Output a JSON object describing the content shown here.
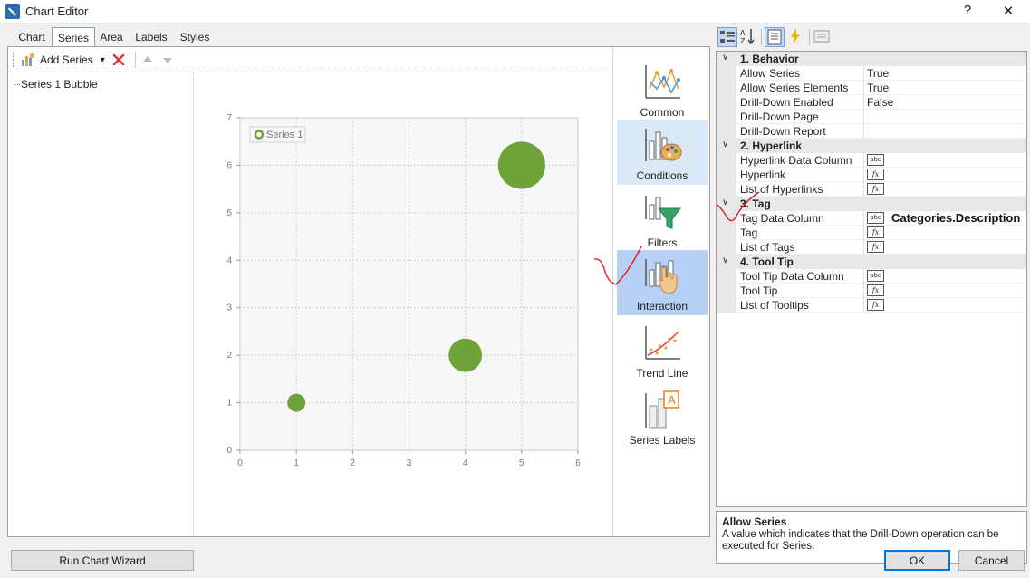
{
  "window": {
    "title": "Chart Editor",
    "help": "?",
    "close": "✕"
  },
  "tabs": [
    {
      "label": "Chart"
    },
    {
      "label": "Series"
    },
    {
      "label": "Area"
    },
    {
      "label": "Labels"
    },
    {
      "label": "Styles"
    }
  ],
  "toolbar": {
    "add_series": "Add Series",
    "dropdown": "▾"
  },
  "tree": {
    "item": "Series 1 Bubble"
  },
  "chart_data": {
    "type": "scatter",
    "subtype": "bubble",
    "legend": "Series 1",
    "legend_position": "top-left",
    "xlim": [
      0,
      6
    ],
    "ylim": [
      0,
      7
    ],
    "x_ticks": [
      "0",
      "1",
      "2",
      "3",
      "4",
      "5",
      "6"
    ],
    "y_ticks": [
      "0",
      "1",
      "2",
      "3",
      "4",
      "5",
      "6",
      "7"
    ],
    "grid": true,
    "series": [
      {
        "name": "Series 1",
        "color": "#6ea33a",
        "points": [
          {
            "x": 1,
            "y": 1,
            "size": 1
          },
          {
            "x": 4,
            "y": 2,
            "size": 2.2
          },
          {
            "x": 5,
            "y": 6,
            "size": 3.3
          }
        ]
      }
    ]
  },
  "side_buttons": [
    {
      "label": "Common",
      "icon": "common-chart-icon"
    },
    {
      "label": "Conditions",
      "icon": "conditions-palette-icon"
    },
    {
      "label": "Filters",
      "icon": "filter-funnel-icon"
    },
    {
      "label": "Interaction",
      "icon": "interaction-hand-icon"
    },
    {
      "label": "Trend Line",
      "icon": "trend-line-icon"
    },
    {
      "label": "Series Labels",
      "icon": "series-labels-icon"
    }
  ],
  "property_grid": {
    "categories": [
      {
        "name": "1. Behavior",
        "props": [
          {
            "name": "Allow Series",
            "value": "True"
          },
          {
            "name": "Allow Series Elements",
            "value": "True"
          },
          {
            "name": "Drill-Down Enabled",
            "value": "False"
          },
          {
            "name": "Drill-Down Page",
            "value": ""
          },
          {
            "name": "Drill-Down Report",
            "value": ""
          }
        ]
      },
      {
        "name": "2. Hyperlink",
        "props": [
          {
            "name": "Hyperlink Data Column",
            "editor": "abc",
            "value": ""
          },
          {
            "name": "Hyperlink",
            "editor": "fx",
            "value": ""
          },
          {
            "name": "List of Hyperlinks",
            "editor": "fx",
            "value": ""
          }
        ]
      },
      {
        "name": "3. Tag",
        "props": [
          {
            "name": "Tag Data Column",
            "editor": "abc",
            "value": "Categories.Description"
          },
          {
            "name": "Tag",
            "editor": "fx",
            "value": ""
          },
          {
            "name": "List of Tags",
            "editor": "fx",
            "value": ""
          }
        ]
      },
      {
        "name": "4. Tool Tip",
        "props": [
          {
            "name": "Tool Tip Data Column",
            "editor": "abc",
            "value": ""
          },
          {
            "name": "Tool Tip",
            "editor": "fx",
            "value": ""
          },
          {
            "name": "List of Tooltips",
            "editor": "fx",
            "value": ""
          }
        ]
      }
    ]
  },
  "description": {
    "title": "Allow Series",
    "text": "A value which indicates that the Drill-Down operation can be executed for Series."
  },
  "buttons": {
    "wizard": "Run Chart Wizard",
    "ok": "OK",
    "cancel": "Cancel"
  },
  "colors": {
    "accent": "#0078d7",
    "bubble": "#6ea33a",
    "annotation": "#e02020"
  }
}
